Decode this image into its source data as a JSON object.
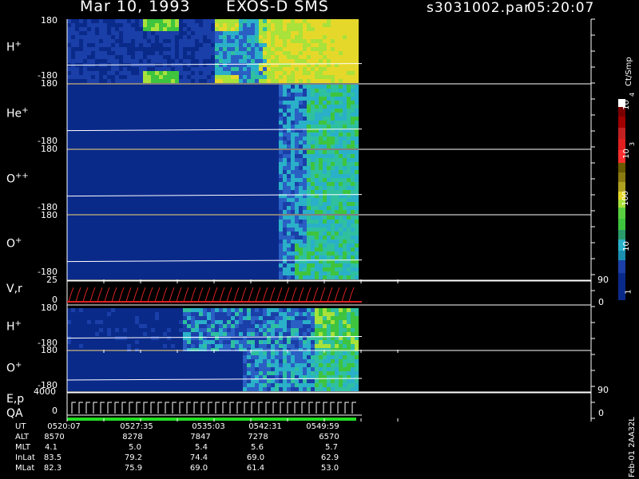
{
  "header": {
    "date": "Mar 10, 1993",
    "instrument": "EXOS-D SMS",
    "file": "s3031002.par",
    "time": "05:20:07"
  },
  "panels": [
    {
      "name": "H",
      "charge": "+",
      "y_top": "180",
      "y_bottom": "-180"
    },
    {
      "name": "He",
      "charge": "+",
      "y_top": "180",
      "y_bottom": "-180"
    },
    {
      "name": "O",
      "charge": "++",
      "y_top": "180",
      "y_bottom": "-180"
    },
    {
      "name": "O",
      "charge": "+",
      "y_top": "180",
      "y_bottom": "-180"
    },
    {
      "name": "H",
      "charge": "+",
      "y_top": "180",
      "y_bottom": "-180"
    },
    {
      "name": "O",
      "charge": "+",
      "y_top": "180",
      "y_bottom": "-180"
    }
  ],
  "vr_panel": {
    "label": "V,r",
    "left_top": "25",
    "left_bottom": "0",
    "right_top": "90",
    "right_bottom": "0"
  },
  "ep_panel": {
    "label_line1": "E,p",
    "label_line2": "QA",
    "left_top": "4000",
    "left_bottom": "0",
    "right_top": "90",
    "right_bottom": "0"
  },
  "colorbar": {
    "unit": "Ct/Smp",
    "labels": [
      "10",
      "4",
      "10",
      "3",
      "100",
      "10",
      "1"
    ]
  },
  "footer_id": "Feb-01 2AA32L",
  "ephemeris": {
    "labels": [
      "UT",
      "ALT",
      "MLT",
      "InLat",
      "MLat"
    ],
    "columns": [
      {
        "UT": "0520:07",
        "ALT": "8570",
        "MLT": "4.1",
        "InLat": "83.5",
        "MLat": "82.3"
      },
      {
        "UT": "0527:35",
        "ALT": "8278",
        "MLT": "5.0",
        "InLat": "79.2",
        "MLat": "75.9"
      },
      {
        "UT": "0535:03",
        "ALT": "7847",
        "MLT": "5.4",
        "InLat": "74.4",
        "MLat": "69.0"
      },
      {
        "UT": "0542:31",
        "ALT": "7278",
        "MLT": "5.6",
        "InLat": "69.0",
        "MLat": "61.4"
      },
      {
        "UT": "0549:59",
        "ALT": "6570",
        "MLT": "5.7",
        "InLat": "62.9",
        "MLat": "53.0"
      }
    ]
  },
  "colors": {
    "background": "#000000",
    "base": "#0a2a8a",
    "teal": "#2ab0c8",
    "green": "#3ec43e",
    "lime": "#a8e23a",
    "yellow": "#e6d82a",
    "red": "#dd2222",
    "white": "#ffffff"
  },
  "chart_data": {
    "type": "heatmap",
    "x_tick_labels": [
      "0520:07",
      "0527:35",
      "0535:03",
      "0542:31",
      "0549:59"
    ],
    "y_range": [
      "-180",
      "180"
    ],
    "color_scale_decades": [
      "1",
      "10",
      "100",
      "10^3",
      "10^4"
    ]
  }
}
